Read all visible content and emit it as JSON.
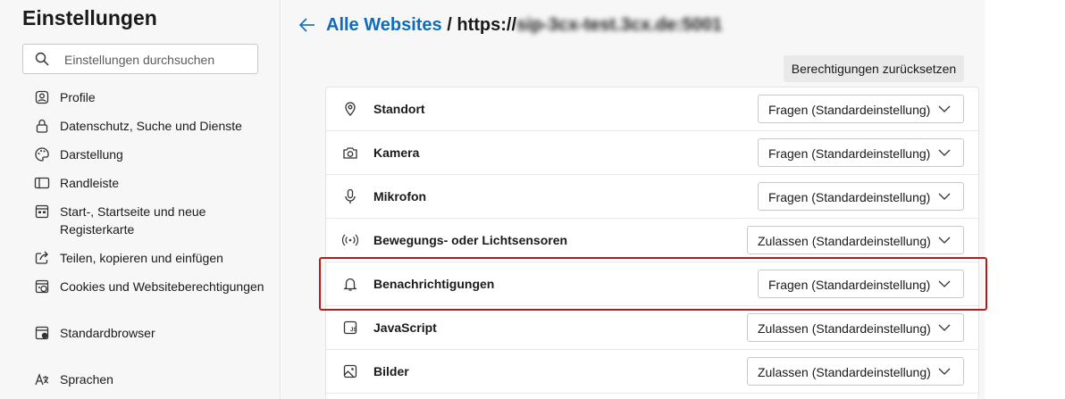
{
  "sidebar": {
    "title": "Einstellungen",
    "search_placeholder": "Einstellungen durchsuchen",
    "items": [
      {
        "label": "Profile",
        "icon": "profile-icon"
      },
      {
        "label": "Datenschutz, Suche und Dienste",
        "icon": "lock-icon"
      },
      {
        "label": "Darstellung",
        "icon": "palette-icon"
      },
      {
        "label": "Randleiste",
        "icon": "sidebar-icon"
      },
      {
        "label": "Start-, Startseite und neue Registerkarte",
        "icon": "home-icon"
      },
      {
        "label": "Teilen, kopieren und einfügen",
        "icon": "share-icon"
      },
      {
        "label": "Cookies und Websiteberechtigungen",
        "icon": "cookie-icon"
      },
      {
        "label": "Standardbrowser",
        "icon": "browser-icon"
      },
      {
        "label": "Sprachen",
        "icon": "language-icon"
      }
    ]
  },
  "header": {
    "breadcrumb_link": "Alle Websites",
    "breadcrumb_sep": " / ",
    "url_prefix": "https://",
    "url_blurred": "sip-3cx-test.3cx.de:5001"
  },
  "reset_button_label": "Berechtigungen zurücksetzen",
  "permissions": [
    {
      "name": "Standort",
      "value": "Fragen (Standardeinstellung)",
      "icon": "location-icon"
    },
    {
      "name": "Kamera",
      "value": "Fragen (Standardeinstellung)",
      "icon": "camera-icon"
    },
    {
      "name": "Mikrofon",
      "value": "Fragen (Standardeinstellung)",
      "icon": "microphone-icon"
    },
    {
      "name": "Bewegungs- oder Lichtsensoren",
      "value": "Zulassen (Standardeinstellung)",
      "icon": "sensor-icon"
    },
    {
      "name": "Benachrichtigungen",
      "value": "Fragen (Standardeinstellung)",
      "icon": "bell-icon"
    },
    {
      "name": "JavaScript",
      "value": "Zulassen (Standardeinstellung)",
      "icon": "javascript-icon"
    },
    {
      "name": "Bilder",
      "value": "Zulassen (Standardeinstellung)",
      "icon": "image-icon"
    }
  ],
  "colors": {
    "accent": "#0f6cbd",
    "highlight": "#b31c1c"
  }
}
